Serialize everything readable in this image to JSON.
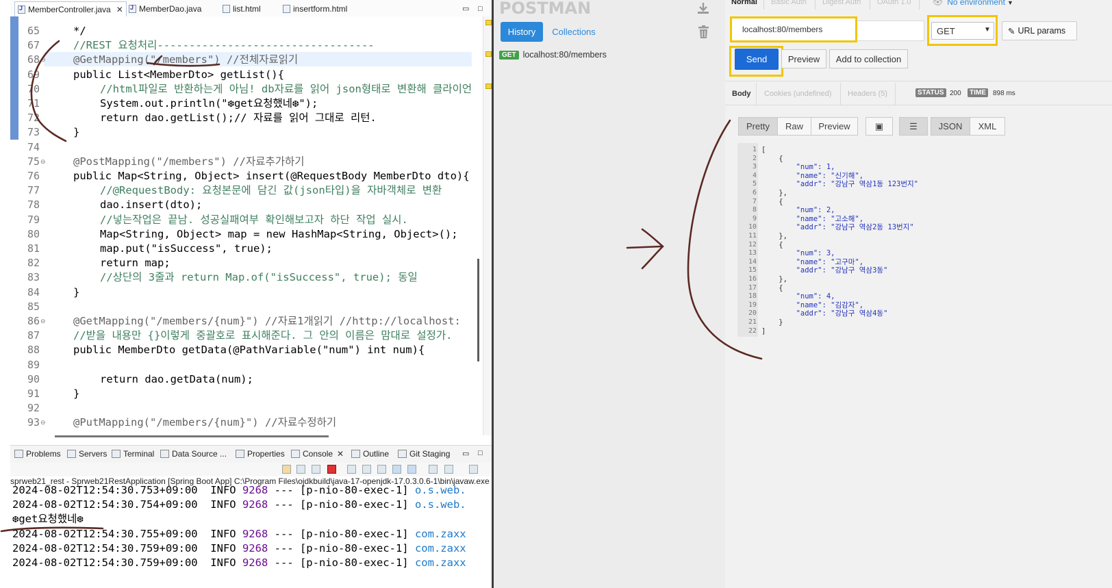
{
  "eclipse": {
    "tabs": [
      {
        "label": "MemberController.java",
        "active": true
      },
      {
        "label": "MemberDao.java"
      },
      {
        "label": "list.html"
      },
      {
        "label": "insertform.html"
      }
    ],
    "code_lines": [
      {
        "num": "65",
        "text": "*/"
      },
      {
        "num": "67",
        "text": "//REST 요청처리----------------------------------"
      },
      {
        "num": "68",
        "text": "@GetMapping(\"/members\") //전체자료읽기"
      },
      {
        "num": "69",
        "text": "public List<MemberDto> getList(){"
      },
      {
        "num": "70",
        "text": "//html파일로 반환하는게 아님! db자료를 읽어 json형태로 변환해 클라이언"
      },
      {
        "num": "71",
        "text": "System.out.println(\"❆get요청했네❆\");"
      },
      {
        "num": "72",
        "text": "return dao.getList();// 자료를 읽어 그대로 리턴."
      },
      {
        "num": "73",
        "text": "}"
      },
      {
        "num": "74",
        "text": ""
      },
      {
        "num": "75",
        "text": "@PostMapping(\"/members\") //자료추가하기"
      },
      {
        "num": "76",
        "text": "public Map<String, Object> insert(@RequestBody MemberDto dto){"
      },
      {
        "num": "77",
        "text": "//@RequestBody: 요청본문에 담긴 값(json타입)을 자바객체로 변환"
      },
      {
        "num": "78",
        "text": "dao.insert(dto);"
      },
      {
        "num": "79",
        "text": "//넣는작업은 끝남. 성공실패여부 확인해보고자 하단 작업 실시."
      },
      {
        "num": "80",
        "text": "Map<String, Object> map = new HashMap<String, Object>();"
      },
      {
        "num": "81",
        "text": "map.put(\"isSuccess\", true);"
      },
      {
        "num": "82",
        "text": "return map;"
      },
      {
        "num": "83",
        "text": "//상단의 3줄과 return Map.of(\"isSuccess\", true); 동일"
      },
      {
        "num": "84",
        "text": "}"
      },
      {
        "num": "85",
        "text": ""
      },
      {
        "num": "86",
        "text": "@GetMapping(\"/members/{num}\") //자료1개읽기 //http://localhost:"
      },
      {
        "num": "87",
        "text": "//받을 내용만 {}이렇게 중괄호로 표시해준다. 그 안의 이름은 맘대로 설정가."
      },
      {
        "num": "88",
        "text": "public MemberDto getData(@PathVariable(\"num\") int num){"
      },
      {
        "num": "89",
        "text": ""
      },
      {
        "num": "90",
        "text": "return dao.getData(num);"
      },
      {
        "num": "91",
        "text": "}"
      },
      {
        "num": "92",
        "text": ""
      },
      {
        "num": "93",
        "text": "@PutMapping(\"/members/{num}\") //자료수정하기"
      }
    ],
    "bottom_tabs": [
      "Problems",
      "Servers",
      "Terminal",
      "Data Source ...",
      "Properties",
      "Console",
      "Outline",
      "Git Staging"
    ],
    "console_desc": "sprweb21_rest - Sprweb21RestApplication [Spring Boot App] C:\\Program Files\\ojdkbuild\\java-17-openjdk-17.0.3.0.6-1\\bin\\javaw.exe",
    "console_lines": [
      {
        "ts": "2024-08-02T12:54:30.753+09:00",
        "level": "INFO",
        "pid": "9268",
        "thread": "--- [p-nio-80-exec-1]",
        "cls": "o.s.web."
      },
      {
        "ts": "2024-08-02T12:54:30.754+09:00",
        "level": "INFO",
        "pid": "9268",
        "thread": "--- [p-nio-80-exec-1]",
        "cls": "o.s.web."
      },
      {
        "plain": "❆get요청했네❆"
      },
      {
        "ts": "2024-08-02T12:54:30.755+09:00",
        "level": "INFO",
        "pid": "9268",
        "thread": "--- [p-nio-80-exec-1]",
        "cls": "com.zaxx"
      },
      {
        "ts": "2024-08-02T12:54:30.759+09:00",
        "level": "INFO",
        "pid": "9268",
        "thread": "--- [p-nio-80-exec-1]",
        "cls": "com.zaxx"
      },
      {
        "ts": "2024-08-02T12:54:30.759+09:00",
        "level": "INFO",
        "pid": "9268",
        "thread": "--- [p-nio-80-exec-1]",
        "cls": "com.zaxx"
      }
    ]
  },
  "postman": {
    "logo": "POSTMAN",
    "history_label": "History",
    "collections_label": "Collections",
    "history_item": {
      "method": "GET",
      "url": "localhost:80/members"
    },
    "auth_tabs": [
      "Normal",
      "Basic Auth",
      "Digest Auth",
      "OAuth 1.0"
    ],
    "environment": "No environment",
    "url_value": "localhost:80/members",
    "method": "GET",
    "url_params_label": "URL params",
    "send_label": "Send",
    "preview_label": "Preview",
    "add_collection_label": "Add to collection",
    "response_tabs": [
      "Body",
      "Cookies (undefined)",
      "Headers (5)"
    ],
    "status_label": "STATUS",
    "status_value": "200",
    "time_label": "TIME",
    "time_value": "898 ms",
    "format_buttons": [
      "Pretty",
      "Raw",
      "Preview"
    ],
    "type_buttons": [
      "JSON",
      "XML"
    ],
    "response_lines": [
      {
        "n": "1",
        "t": "["
      },
      {
        "n": "2",
        "t": "    {"
      },
      {
        "n": "3",
        "t": "        \"num\": 1,"
      },
      {
        "n": "4",
        "t": "        \"name\": \"신기해\","
      },
      {
        "n": "5",
        "t": "        \"addr\": \"강남구 역삼1동 123번지\""
      },
      {
        "n": "6",
        "t": "    },"
      },
      {
        "n": "7",
        "t": "    {"
      },
      {
        "n": "8",
        "t": "        \"num\": 2,"
      },
      {
        "n": "9",
        "t": "        \"name\": \"고소해\","
      },
      {
        "n": "10",
        "t": "        \"addr\": \"강남구 역삼2동 13번지\""
      },
      {
        "n": "11",
        "t": "    },"
      },
      {
        "n": "12",
        "t": "    {"
      },
      {
        "n": "13",
        "t": "        \"num\": 3,"
      },
      {
        "n": "14",
        "t": "        \"name\": \"고구마\","
      },
      {
        "n": "15",
        "t": "        \"addr\": \"강남구 역삼3동\""
      },
      {
        "n": "16",
        "t": "    },"
      },
      {
        "n": "17",
        "t": "    {"
      },
      {
        "n": "18",
        "t": "        \"num\": 4,"
      },
      {
        "n": "19",
        "t": "        \"name\": \"김감자\","
      },
      {
        "n": "20",
        "t": "        \"addr\": \"강남구 역삼4동\""
      },
      {
        "n": "21",
        "t": "    }"
      },
      {
        "n": "22",
        "t": "]"
      }
    ]
  },
  "colors": {
    "highlight_box": "#f2c500",
    "send_blue": "#1b6ad6",
    "history_blue": "#2c88d9",
    "ink": "#5a2a22"
  }
}
